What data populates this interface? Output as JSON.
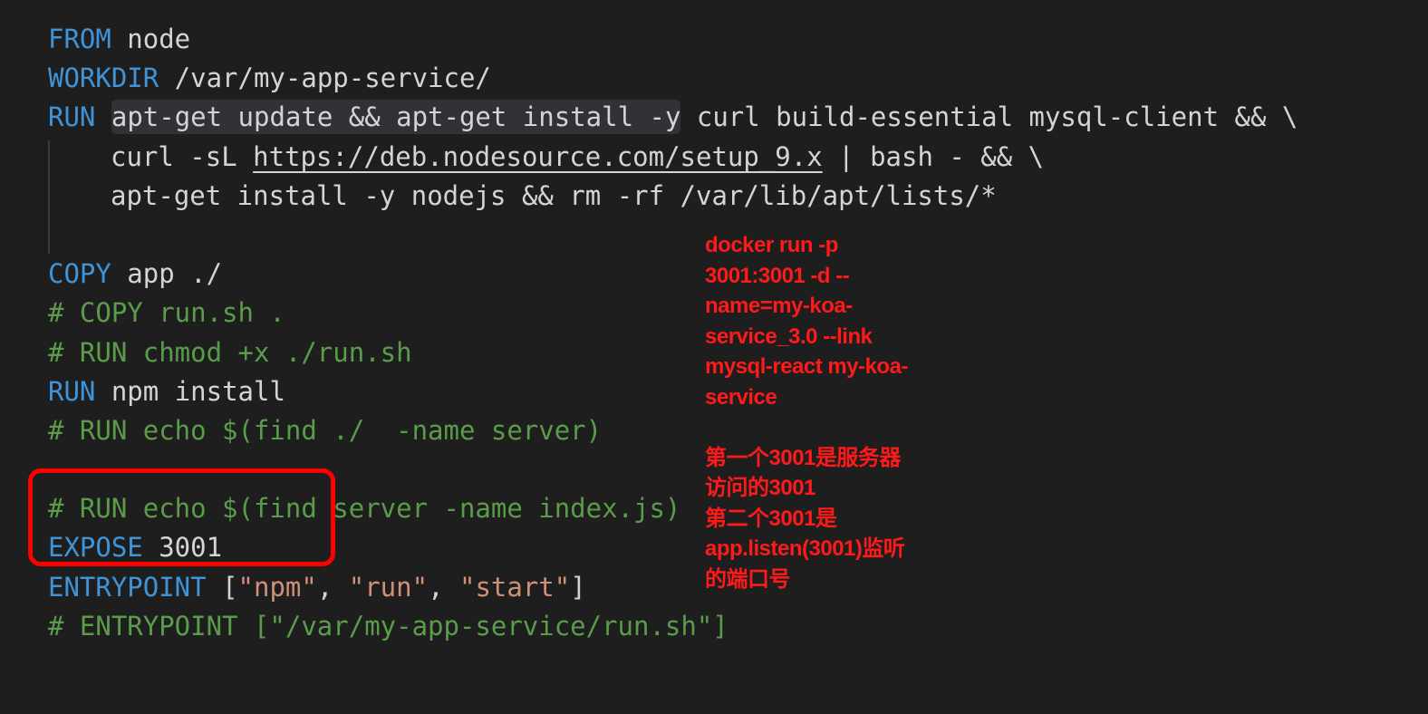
{
  "code": {
    "l1": {
      "kw": "FROM",
      "text": " node"
    },
    "l2": {
      "kw": "WORKDIR",
      "text": " /var/my-app-service/"
    },
    "l3": {
      "kw": "RUN",
      "sp": " ",
      "sel": "apt-get update && apt-get install -y",
      "text": " curl build-essential mysql-client && \\"
    },
    "l4": {
      "pre": "curl -sL ",
      "url": "https://deb.nodesource.com/setup_9.x",
      "post": " | bash - && \\"
    },
    "l5": {
      "text": "apt-get install -y nodejs && rm -rf /var/lib/apt/lists/*"
    },
    "l7": {
      "kw": "COPY",
      "text": " app ./"
    },
    "l8": {
      "comment": "# COPY run.sh ."
    },
    "l9": {
      "comment": "# RUN chmod +x ./run.sh"
    },
    "l10": {
      "kw": "RUN",
      "text": " npm install"
    },
    "l11": {
      "comment": "# RUN echo $(find ./  -name server)"
    },
    "l13": {
      "comment": "# RUN echo $(find server -name index.js)"
    },
    "l14": {
      "kw": "EXPOSE",
      "num": " 3001"
    },
    "l15": {
      "kw": "ENTRYPOINT",
      "p1": " [",
      "s1": "\"npm\"",
      "c1": ", ",
      "s2": "\"run\"",
      "c2": ", ",
      "s3": "\"start\"",
      "p2": "]"
    },
    "l16": {
      "comment": "# ENTRYPOINT [\"/var/my-app-service/run.sh\"]"
    }
  },
  "annotation": {
    "lines1": [
      "docker run -p",
      "3001:3001 -d  --",
      "name=my-koa-",
      "service_3.0 --link",
      "mysql-react my-koa-",
      "service"
    ],
    "lines2": [
      "第一个3001是服务器",
      "访问的3001",
      "第二个3001是",
      "app.listen(3001)监听",
      "的端口号"
    ]
  },
  "colors": {
    "background": "#1e1e1e",
    "keyword": "#3f93d6",
    "comment": "#5a9c4a",
    "string": "#ce9178",
    "annotation": "#ff1a1a",
    "highlight_box": "#ff0000"
  }
}
